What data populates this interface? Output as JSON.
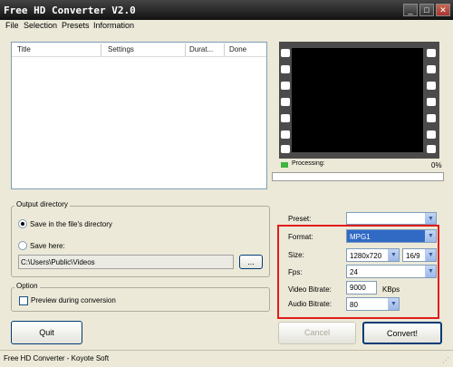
{
  "window": {
    "title": "Free HD Converter V2.0",
    "min": "_",
    "max": "□",
    "close": "✕"
  },
  "menu": [
    "File",
    "Selection",
    "Presets",
    "Information"
  ],
  "list": {
    "columns": [
      "Title",
      "Settings",
      "Durat...",
      "Done"
    ]
  },
  "progress": {
    "label": "Processing:",
    "percent_text": "0%",
    "value": 0
  },
  "output": {
    "group_label": "Output directory",
    "radio_same_label": "Save in the file's directory",
    "radio_here_label": "Save here:",
    "path": "C:\\Users\\Public\\Videos",
    "browse_label": "..."
  },
  "option": {
    "group_label": "Option",
    "preview_label": "Preview during conversion"
  },
  "buttons": {
    "quit": "Quit",
    "cancel": "Cancel",
    "convert": "Convert!"
  },
  "settings": {
    "preset_label": "Preset:",
    "preset_value": "",
    "format_label": "Format:",
    "format_value": "MPG1",
    "size_label": "Size:",
    "size_value": "1280x720",
    "aspect_value": "16/9",
    "fps_label": "Fps:",
    "fps_value": "24",
    "video_bitrate_label": "Video Bitrate:",
    "video_bitrate_value": "9000",
    "video_bitrate_unit": "KBps",
    "audio_bitrate_label": "Audio Bitrate:",
    "audio_bitrate_value": "80"
  },
  "status": {
    "text": "Free HD Converter - Koyote Soft"
  },
  "colors": {
    "highlight": "#e21b1b",
    "progress_green": "#3fb43f"
  }
}
